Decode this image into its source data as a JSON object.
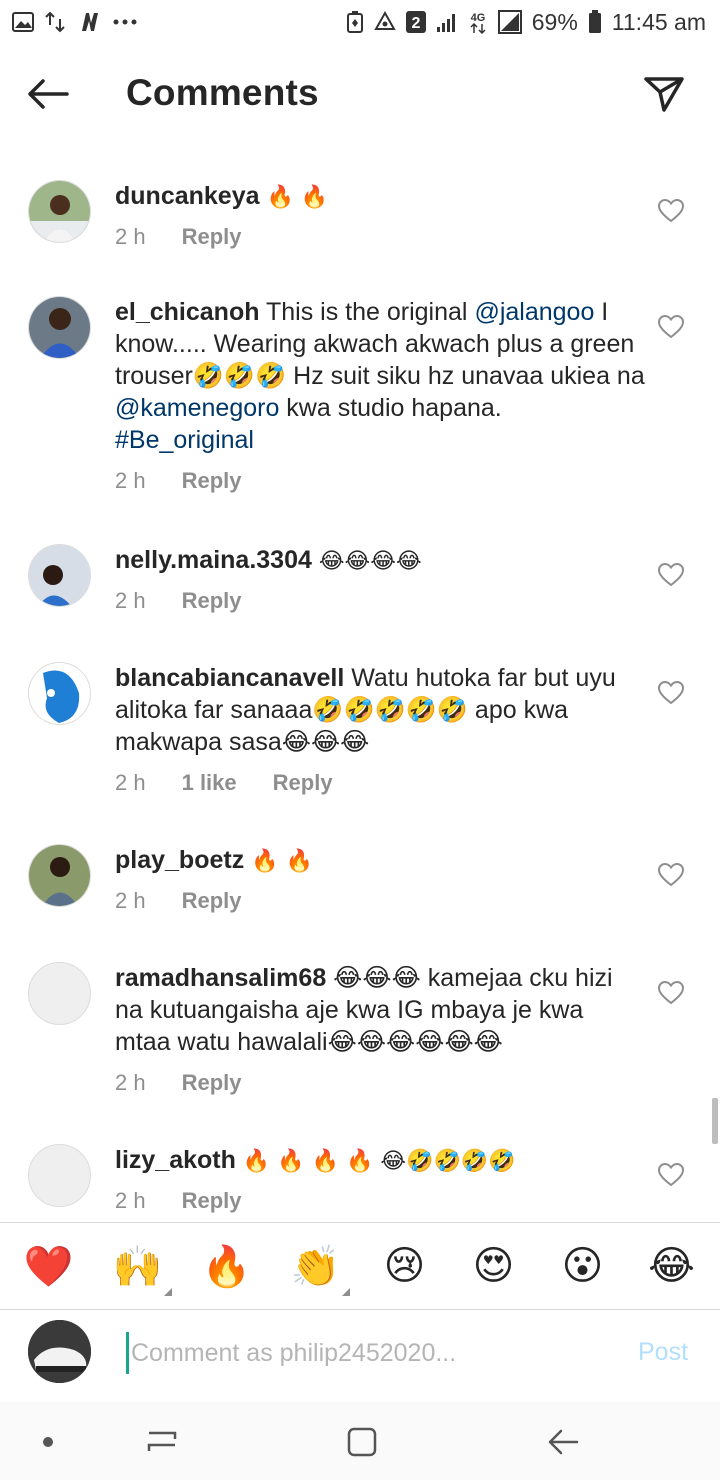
{
  "status_bar": {
    "battery": "69%",
    "time": "11:45 am",
    "sim_badge": "2",
    "network": "4G"
  },
  "header": {
    "title": "Comments"
  },
  "comments": [
    {
      "username": "duncankeya",
      "text": "",
      "emojis": "🔥 🔥",
      "time": "2 h",
      "likes": "",
      "reply": "Reply"
    },
    {
      "username": "el_chicanoh",
      "text_parts": [
        "This is the original ",
        "@jalangoo",
        " I know..... Wearing akwach akwach plus a green trouser🤣🤣🤣 Hz suit siku hz unavaa ukiea na ",
        "@kamenegoro",
        " kwa studio hapana. ",
        "#Be_original"
      ],
      "time": "2 h",
      "likes": "",
      "reply": "Reply"
    },
    {
      "username": "nelly.maina.3304",
      "text": "",
      "emojis": "😂😂😂😂",
      "time": "2 h",
      "likes": "",
      "reply": "Reply"
    },
    {
      "username": "blancabiancanavell",
      "text": "Watu hutoka far but uyu alitoka far sanaaa🤣🤣🤣🤣🤣 apo kwa makwapa sasa😂😂😂",
      "time": "2 h",
      "likes": "1 like",
      "reply": "Reply"
    },
    {
      "username": "play_boetz",
      "text": "",
      "emojis": "🔥 🔥",
      "time": "2 h",
      "likes": "",
      "reply": "Reply"
    },
    {
      "username": "ramadhansalim68",
      "text": "😂😂😂 kamejaa cku hizi na kutuangaisha aje kwa IG mbaya je kwa mtaa watu hawalali😂😂😂😂😂😂",
      "time": "2 h",
      "likes": "",
      "reply": "Reply"
    },
    {
      "username": "lizy_akoth",
      "text": "",
      "emojis": "🔥 🔥 🔥 🔥 😂🤣🤣🤣🤣",
      "time": "2 h",
      "likes": "",
      "reply": "Reply"
    }
  ],
  "emoji_bar": [
    "❤️",
    "🙌",
    "🔥",
    "👏",
    "😢",
    "😍",
    "😮",
    "😂"
  ],
  "composer": {
    "placeholder": "Comment as philip2452020...",
    "post_label": "Post"
  },
  "colors": {
    "link": "#00376b",
    "meta": "#8e8e8e",
    "post_disabled": "#b2dffc",
    "cursor": "#1aa591"
  }
}
